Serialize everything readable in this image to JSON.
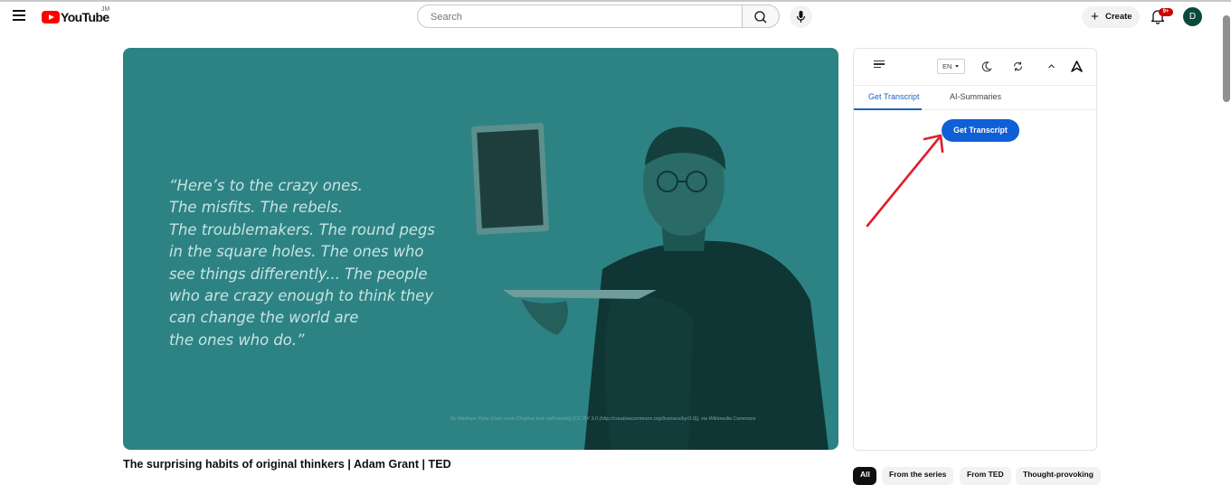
{
  "header": {
    "logo_text": "YouTube",
    "country_code": "JM",
    "search_placeholder": "Search",
    "create_label": "Create",
    "notification_count": "9+",
    "avatar_letter": "D"
  },
  "video": {
    "quote_text": "“Here’s to the crazy ones.\nThe misfits. The rebels.\nThe troublemakers. The round pegs\nin the square holes. The ones who\nsee things differently... The people\nwho are crazy enough to think they\ncan change the world are\nthe ones who do.”",
    "credit_text": "By Matthew Yohe (Own work (Original text: self-made)) [CC BY 3.0 (http://creativecommons.org/licenses/by/3.0)], via Wikimedia Commons",
    "title": "The surprising habits of original thinkers | Adam Grant | TED"
  },
  "panel": {
    "language": "EN",
    "tabs": [
      {
        "label": "Get Transcript",
        "active": true
      },
      {
        "label": "AI-Summaries",
        "active": false
      }
    ],
    "get_transcript_button": "Get Transcript"
  },
  "chips": [
    {
      "label": "All",
      "active": true
    },
    {
      "label": "From the series"
    },
    {
      "label": "From TED"
    },
    {
      "label": "Thought-provoking"
    }
  ],
  "colors": {
    "brand_red": "#ff0000",
    "video_teal": "#2d8384",
    "button_blue": "#0f5fd6",
    "annotation_red": "#e11d2a",
    "tab_active_blue": "#1b63c9"
  }
}
